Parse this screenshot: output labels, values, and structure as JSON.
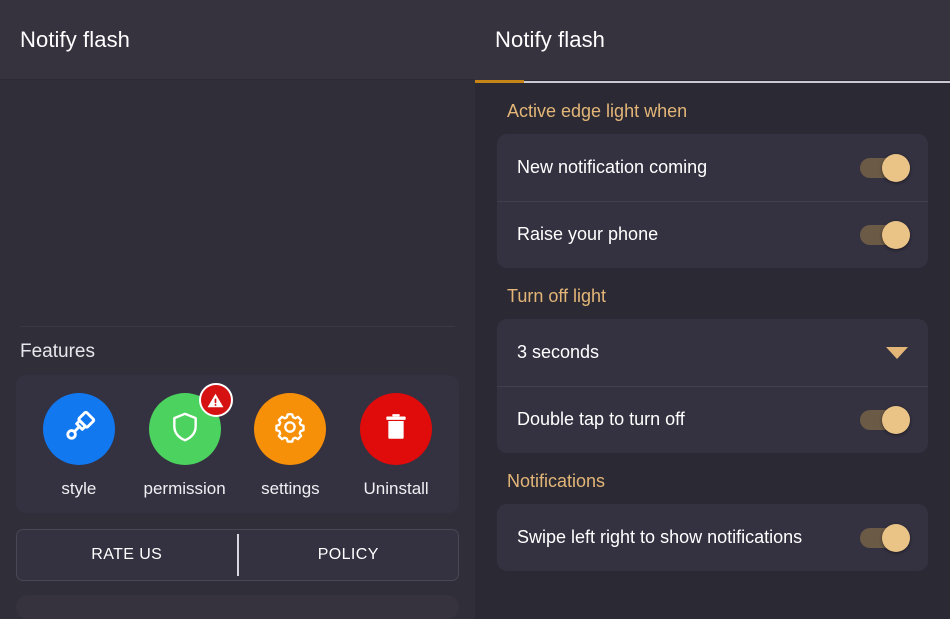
{
  "left": {
    "appbar": {
      "title": "Notify flash"
    },
    "features": {
      "label": "Features",
      "items": [
        {
          "label": "style",
          "icon": "paintbrush-icon",
          "color": "#1278f0",
          "badge": false
        },
        {
          "label": "permission",
          "icon": "shield-icon",
          "color": "#4cd25f",
          "badge": true,
          "badge_icon": "warning-triangle-icon"
        },
        {
          "label": "settings",
          "icon": "gear-icon",
          "color": "#f79009",
          "badge": false
        },
        {
          "label": "Uninstall",
          "icon": "trash-icon",
          "color": "#e00b0b",
          "badge": false
        }
      ]
    },
    "buttons": {
      "rate_us": "RATE US",
      "policy": "POLICY"
    }
  },
  "right": {
    "appbar": {
      "title": "Notify flash"
    },
    "sections": [
      {
        "header": "Active edge light when",
        "rows": [
          {
            "label": "New notification coming",
            "control": "toggle",
            "value": "on"
          },
          {
            "label": "Raise your phone",
            "control": "toggle",
            "value": "on"
          }
        ]
      },
      {
        "header": "Turn off light",
        "rows": [
          {
            "label": "3 seconds",
            "control": "dropdown",
            "icon": "chevron-down-icon"
          },
          {
            "label": "Double tap to turn off",
            "control": "toggle",
            "value": "on"
          }
        ]
      },
      {
        "header": "Notifications",
        "rows": [
          {
            "label": "Swipe left right to show notifications",
            "control": "toggle",
            "value": "on"
          }
        ]
      }
    ]
  },
  "theme": {
    "accent": "#e3b678",
    "tab_indicator": "#c78417",
    "appbar_bg": "#36333f",
    "left_bg": "#302e39",
    "right_bg": "#2b2933",
    "card_bg": "#343140",
    "toggle_thumb": "#eac387",
    "toggle_track": "#6b5a45"
  }
}
